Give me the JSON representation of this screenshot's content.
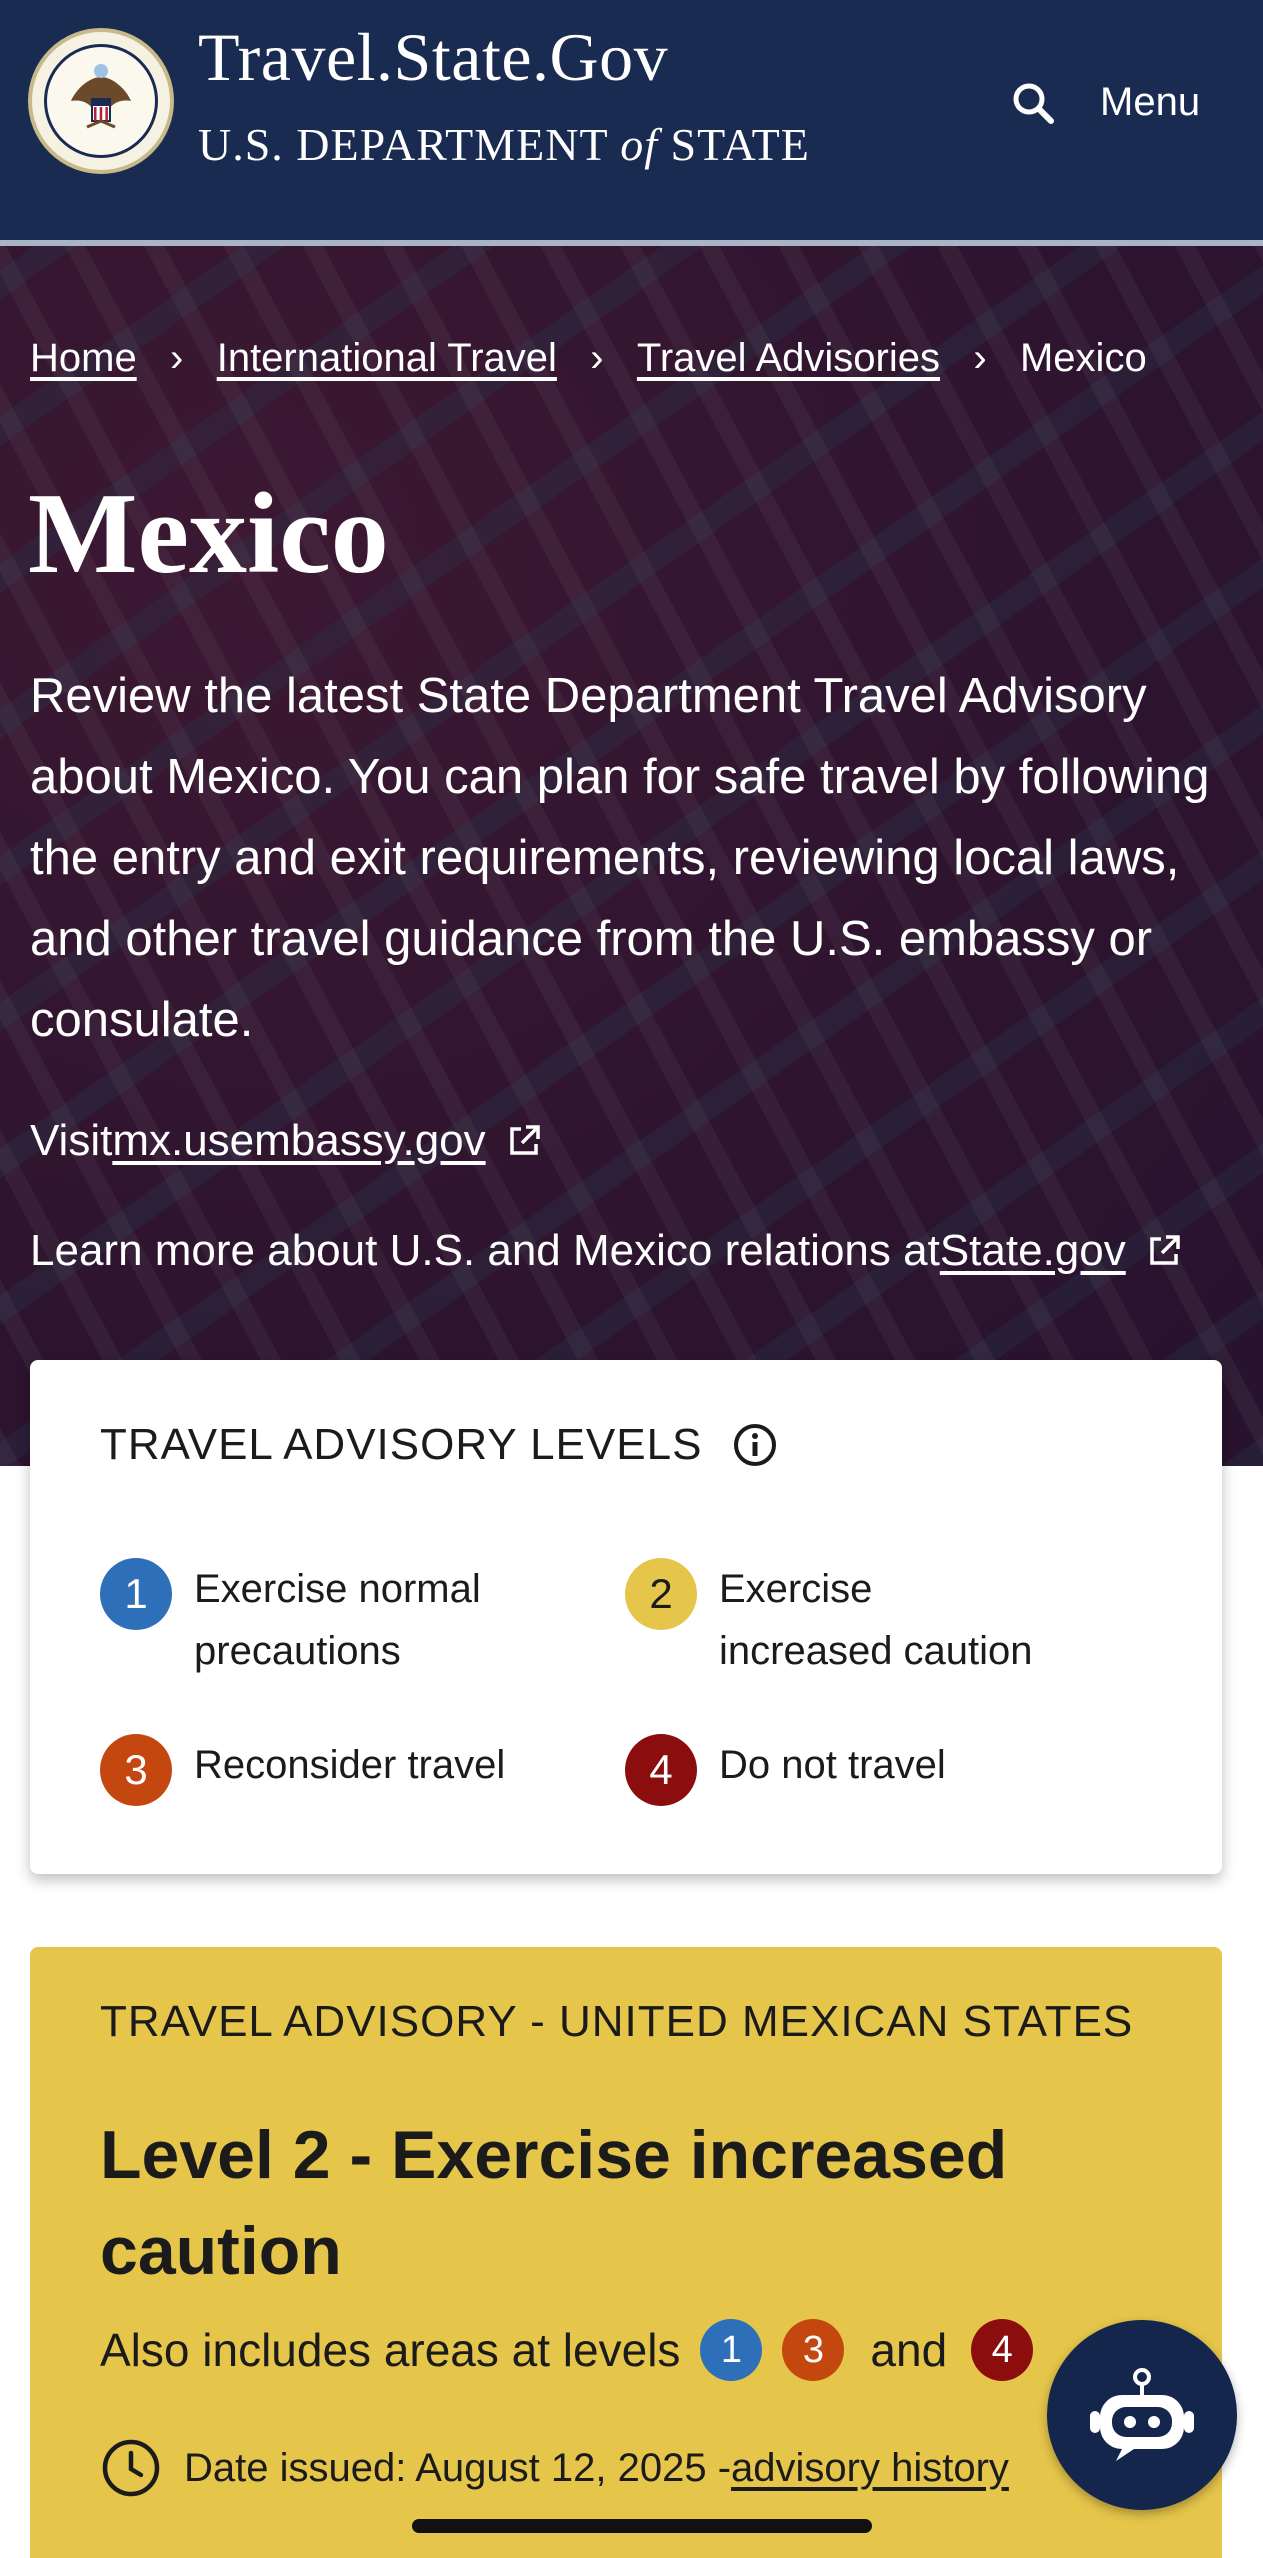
{
  "header": {
    "title": "Travel.State.Gov",
    "subtitle_pre": "U.S. DEPARTMENT ",
    "subtitle_of": "of",
    "subtitle_post": " STATE",
    "menu_label": "Menu",
    "search_icon": "search-icon",
    "colors": {
      "background": "#1a2b52"
    }
  },
  "breadcrumb": {
    "items": [
      "Home",
      "International Travel",
      "Travel Advisories"
    ],
    "current": "Mexico"
  },
  "hero": {
    "title": "Mexico",
    "intro": "Review the latest State Department Travel Advisory about Mexico. You can plan for safe travel by following the entry and exit requirements, reviewing local laws, and other travel guidance from the U.S. embassy or consulate.",
    "visit_prefix": "Visit ",
    "visit_link": "mx.usembassy.gov",
    "learn_prefix": "Learn more about U.S. and Mexico relations at ",
    "learn_link": "State.gov"
  },
  "levels_card": {
    "title": "TRAVEL ADVISORY LEVELS",
    "levels": [
      {
        "num": "1",
        "label": "Exercise normal precautions",
        "color": "#2e6fba"
      },
      {
        "num": "2",
        "label": "Exercise increased caution",
        "color": "#e5c54a"
      },
      {
        "num": "3",
        "label": "Reconsider travel",
        "color": "#c4470f"
      },
      {
        "num": "4",
        "label": "Do not travel",
        "color": "#8b0d0d"
      }
    ]
  },
  "advisory": {
    "heading": "TRAVEL ADVISORY - UNITED MEXICAN STATES",
    "level_text": "Level 2 - Exercise increased caution",
    "includes_prefix": "Also includes areas at levels",
    "includes_levels": [
      "1",
      "3",
      "4"
    ],
    "includes_and": "and",
    "date_text": "Date issued: August 12, 2025 - ",
    "history_link": "advisory history",
    "color": "#e5c54a"
  },
  "chatbot": {
    "icon": "chatbot-icon"
  }
}
